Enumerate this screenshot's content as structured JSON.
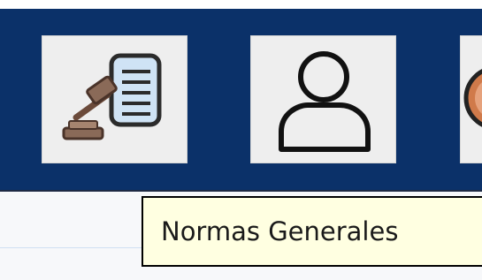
{
  "toolbar": {
    "background": "#0b3169",
    "buttons": [
      {
        "name": "normas-generales",
        "icon": "gavel-document-icon",
        "tooltip": "Normas Generales"
      },
      {
        "name": "usuario",
        "icon": "user-icon"
      },
      {
        "name": "third",
        "icon": "circle-icon"
      }
    ]
  },
  "tooltip": {
    "text": "Normas Generales",
    "background": "#ffffe1"
  }
}
